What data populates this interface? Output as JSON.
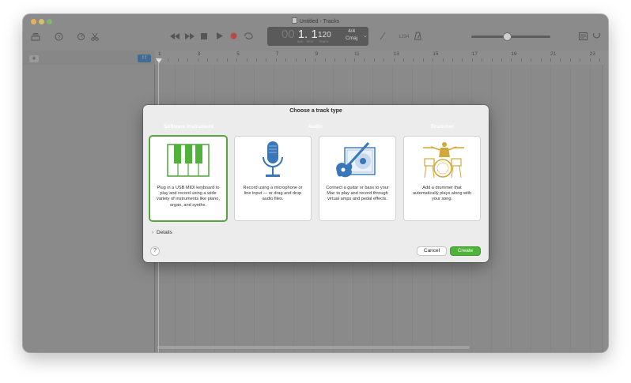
{
  "window": {
    "title": "Untitled - Tracks"
  },
  "toolbar": {
    "icons": [
      "library-icon",
      "help-icon",
      "smart-controls-icon",
      "scissors-icon",
      "rewind-icon",
      "fast-forward-icon",
      "stop-icon",
      "play-icon",
      "record-icon",
      "cycle-icon",
      "tuner-icon",
      "count-in-icon",
      "metronome-icon",
      "notepad-icon",
      "loop-browser-icon"
    ],
    "count_in_label": "1234",
    "lcd": {
      "bar_prefix": "00",
      "bar": "1. 1",
      "beat_label": "BAR",
      "beat_label2": "BEAT",
      "tempo": "120",
      "tempo_label": "TEMPO",
      "sig_top": "4/4",
      "sig_bottom": "Cmaj"
    },
    "master_volume": 0.45
  },
  "ruler": {
    "numbers": [
      "1",
      "3",
      "5",
      "7",
      "9",
      "11",
      "13",
      "15",
      "17",
      "19",
      "21",
      "23"
    ]
  },
  "dialog": {
    "title": "Choose a track type",
    "categories": [
      {
        "label": "Software Instrument",
        "color": "#4fb33b"
      },
      {
        "label": "Audio",
        "color": "#3a76ba"
      },
      {
        "label": "Drummer",
        "color": "#cfa83c"
      }
    ],
    "cards": [
      {
        "icon": "keyboard-icon",
        "desc": "Plug in a USB MIDI keyboard to play and record using a wide variety of instruments like piano, organ, and synths."
      },
      {
        "icon": "microphone-icon",
        "desc": "Record using a microphone or line input — or drag and drop audio files."
      },
      {
        "icon": "guitar-icon",
        "desc": "Connect a guitar or bass to your Mac to play and record through virtual amps and pedal effects."
      },
      {
        "icon": "drummer-icon",
        "desc": "Add a drummer that automatically plays along with your song."
      }
    ],
    "details_label": "Details",
    "help_label": "?",
    "cancel_label": "Cancel",
    "create_label": "Create"
  }
}
